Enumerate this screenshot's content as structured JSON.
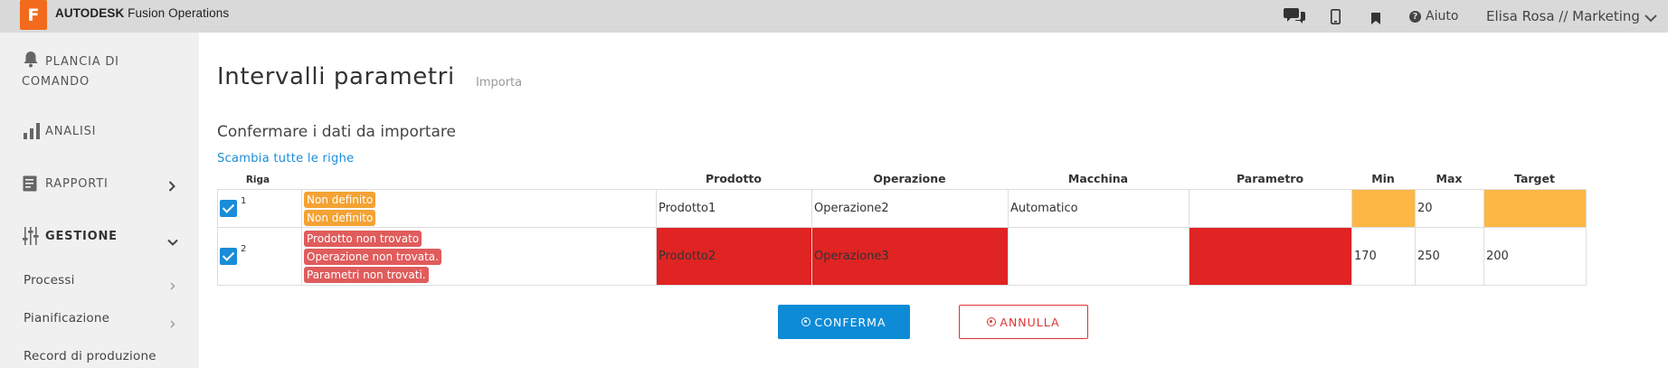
{
  "topbar": {
    "logo_letter": "F",
    "brand_bold": "AUTODESK",
    "brand_rest": "Fusion Operations",
    "help_label": "Aiuto",
    "user_label": "Elisa Rosa // Marketing"
  },
  "sidebar": {
    "dashboard_label": "PLANCIA DI\nCOMANDO",
    "analysis_label": "ANALISI",
    "reports_label": "RAPPORTI",
    "management_label": "GESTIONE",
    "sub_items": [
      "Processi",
      "Pianificazione",
      "Record di produzione"
    ]
  },
  "main": {
    "title": "Intervalli parametri",
    "subtitle": "Importa",
    "section_title": "Confermare i dati da importare",
    "swap_link": "Scambia tutte le righe",
    "columns": {
      "row": "Riga",
      "product": "Prodotto",
      "operation": "Operazione",
      "machine": "Macchina",
      "parameter": "Parametro",
      "min": "Min",
      "max": "Max",
      "target": "Target"
    },
    "rows": [
      {
        "num": "1",
        "messages": [
          "Non definito",
          "Non definito"
        ],
        "product": "Prodotto1",
        "operation": "Operazione2",
        "machine": "Automatico",
        "parameter": "",
        "min": "",
        "max": "20",
        "target": ""
      },
      {
        "num": "2",
        "messages": [
          "Prodotto non trovato",
          "Operazione non trovata.",
          "Parametri non trovati."
        ],
        "product": "Prodotto2",
        "operation": "Operazione3",
        "machine": "",
        "parameter": "",
        "min": "170",
        "max": "250",
        "target": "200"
      }
    ],
    "confirm_button": "CONFERMA",
    "cancel_button": "ANNULLA"
  },
  "colors": {
    "accent": "#0d8bd6",
    "warning": "#fdb744",
    "error": "#e02323",
    "cancel": "#dd3333",
    "logo": "#f26b1d"
  }
}
